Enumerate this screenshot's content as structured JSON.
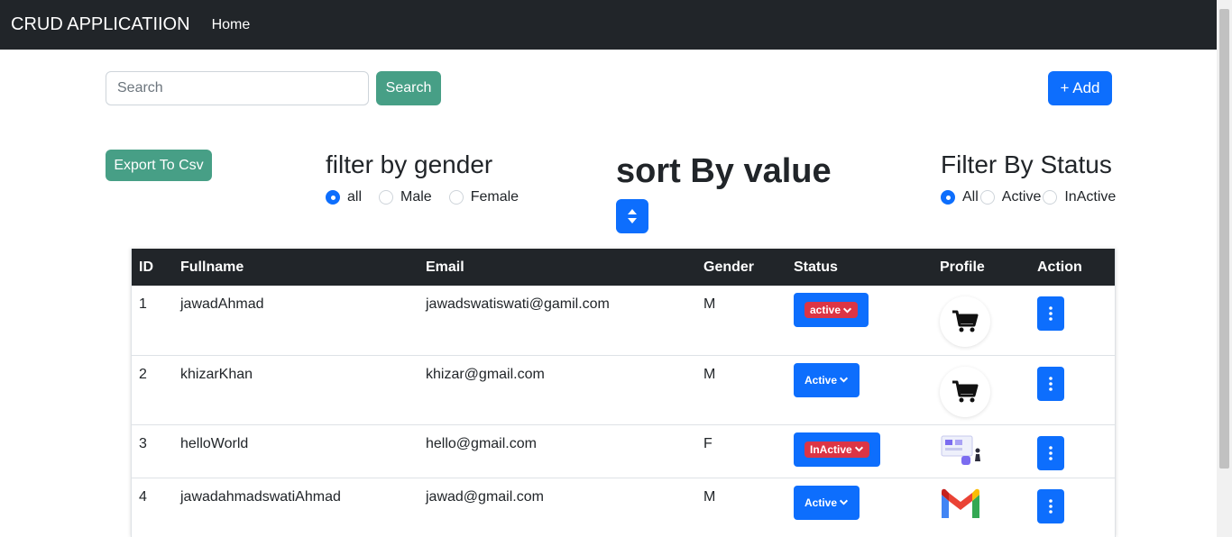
{
  "navbar": {
    "brand": "CRUD APPLICATIION",
    "home": "Home"
  },
  "search": {
    "placeholder": "Search",
    "button": "Search"
  },
  "add_button": "+ Add",
  "export_button": "Export To Csv",
  "gender_filter": {
    "title": "filter by gender",
    "options": [
      "all",
      "Male",
      "Female"
    ],
    "selected": "all"
  },
  "sort": {
    "title": "sort By value",
    "icon": "sort-icon"
  },
  "status_filter": {
    "title": "Filter By Status",
    "options": [
      "All",
      "Active",
      "InActive"
    ],
    "selected": "All"
  },
  "table": {
    "headers": [
      "ID",
      "Fullname",
      "Email",
      "Gender",
      "Status",
      "Profile",
      "Action"
    ],
    "rows": [
      {
        "id": "1",
        "fullname": "jawadAhmad",
        "email": "jawadswatiswati@gamil.com",
        "gender": "M",
        "status": "active",
        "status_style": "red-pill",
        "profile_icon": "cart-icon"
      },
      {
        "id": "2",
        "fullname": "khizarKhan",
        "email": "khizar@gmail.com",
        "gender": "M",
        "status": "Active",
        "status_style": "plain",
        "profile_icon": "cart-icon"
      },
      {
        "id": "3",
        "fullname": "helloWorld",
        "email": "hello@gmail.com",
        "gender": "F",
        "status": "InActive",
        "status_style": "red-pill",
        "profile_icon": "illustration-icon"
      },
      {
        "id": "4",
        "fullname": "jawadahmadswatiAhmad",
        "email": "jawad@gmail.com",
        "gender": "M",
        "status": "Active",
        "status_style": "plain",
        "profile_icon": "gmail-icon"
      }
    ]
  },
  "colors": {
    "navbar": "#212529",
    "primary": "#0d6efd",
    "success": "#479f86",
    "danger": "#dc3545"
  }
}
